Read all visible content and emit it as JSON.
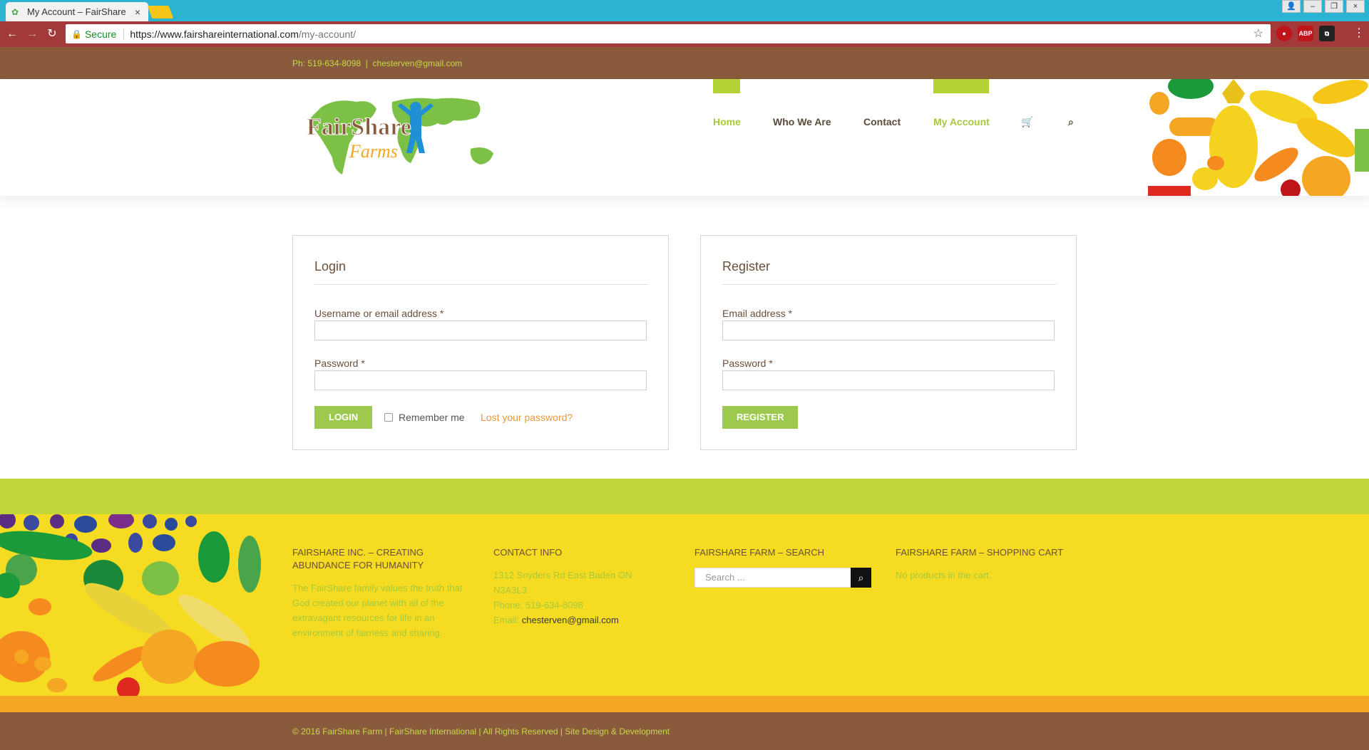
{
  "browser": {
    "tab_title": "My Account – FairShare",
    "secure_label": "Secure",
    "url_host": "https://www.fairshareinternational.com",
    "url_path": "/my-account/",
    "extensions": [
      "ABP"
    ]
  },
  "topbar": {
    "phone": "Ph: 519-634-8098",
    "separator": "|",
    "email": "chesterven@gmail.com"
  },
  "logo": {
    "word1": "FairShare",
    "word2": "Farms"
  },
  "nav": {
    "items": [
      {
        "label": "Home"
      },
      {
        "label": "Who We Are"
      },
      {
        "label": "Contact"
      },
      {
        "label": "My Account"
      }
    ]
  },
  "login": {
    "title": "Login",
    "username_label": "Username or email address *",
    "password_label": "Password *",
    "button": "LOGIN",
    "remember": "Remember me",
    "lost": "Lost your password?"
  },
  "register": {
    "title": "Register",
    "email_label": "Email address *",
    "password_label": "Password *",
    "button": "REGISTER"
  },
  "footer": {
    "col1": {
      "heading": "FAIRSHARE INC. – CREATING ABUNDANCE FOR HUMANITY",
      "line1": "The FairShare family values the truth that God created our planet with all of the",
      "line2": "extravagant resources for life in an environment of fairness and sharing."
    },
    "col2": {
      "heading": "CONTACT INFO",
      "address": "1312 Snyders Rd East Baden ON N3A3L3",
      "phone": "Phone: 519-634-8098",
      "email_label": "Email:",
      "email": "chesterven@gmail.com"
    },
    "col3": {
      "heading": "FAIRSHARE FARM – SEARCH",
      "placeholder": "Search ..."
    },
    "col4": {
      "heading": "FAIRSHARE FARM – SHOPPING CART",
      "empty": "No products in the cart."
    },
    "copyright": "© 2016 FairShare Farm | FairShare International | All Rights Reserved | Site Design & Development"
  },
  "colors": {
    "brown": "#8a5a3c",
    "green": "#a7c93b",
    "yellow": "#f5dc22",
    "orange": "#f5a623"
  }
}
